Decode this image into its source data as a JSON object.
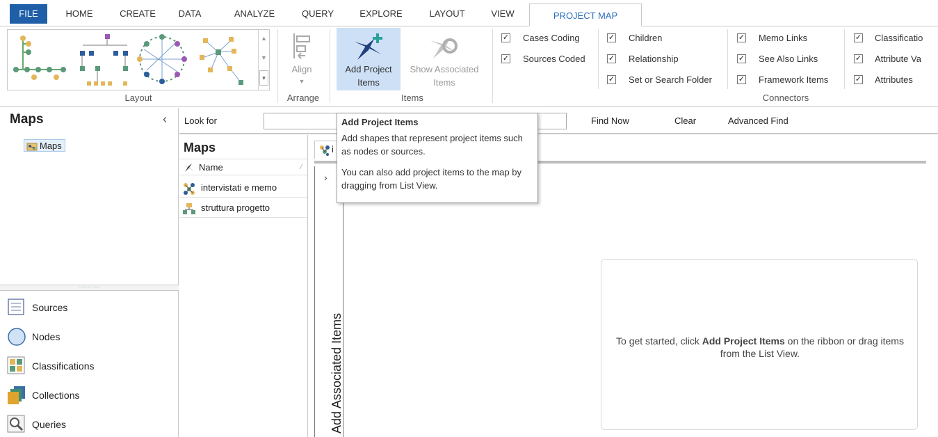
{
  "tabs": [
    {
      "label": "FILE"
    },
    {
      "label": "HOME"
    },
    {
      "label": "CREATE"
    },
    {
      "label": "DATA"
    },
    {
      "label": "ANALYZE"
    },
    {
      "label": "QUERY"
    },
    {
      "label": "EXPLORE"
    },
    {
      "label": "LAYOUT"
    },
    {
      "label": "VIEW"
    },
    {
      "label": "PROJECT MAP"
    }
  ],
  "ribbon": {
    "groups": {
      "layout": "Layout",
      "arrange": "Arrange",
      "items": "Items",
      "connectors": "Connectors"
    },
    "align_label": "Align",
    "add_project_items": {
      "line1": "Add Project",
      "line2": "Items"
    },
    "show_associated_items": {
      "line1": "Show Associated",
      "line2": "Items"
    },
    "checkboxes": [
      {
        "label": "Cases Coding",
        "checked": true
      },
      {
        "label": "Sources Coded",
        "checked": true
      },
      {
        "label": "Children",
        "checked": true
      },
      {
        "label": "Relationship",
        "checked": true
      },
      {
        "label": "Set or Search Folder",
        "checked": true
      },
      {
        "label": "Memo Links",
        "checked": true
      },
      {
        "label": "See Also Links",
        "checked": true
      },
      {
        "label": "Framework Items",
        "checked": true
      },
      {
        "label": "Classificatio",
        "checked": true
      },
      {
        "label": "Attribute Va",
        "checked": true
      },
      {
        "label": "Attributes",
        "checked": true
      }
    ],
    "check_mark": "✓"
  },
  "navigation": {
    "title": "Maps",
    "collapse_glyph": "‹",
    "tree_item": "Maps",
    "categories": [
      {
        "label": "Sources",
        "icon": "sources-icon"
      },
      {
        "label": "Nodes",
        "icon": "nodes-icon"
      },
      {
        "label": "Classifications",
        "icon": "classifications-icon"
      },
      {
        "label": "Collections",
        "icon": "collections-icon"
      },
      {
        "label": "Queries",
        "icon": "queries-icon"
      }
    ]
  },
  "find": {
    "look_for": "Look for",
    "find_now": "Find Now",
    "clear": "Clear",
    "advanced_find": "Advanced Find"
  },
  "list": {
    "title": "Maps",
    "column_name": "Name",
    "rows": [
      {
        "name": "intervistati e memo",
        "icon": "project-map-icon"
      },
      {
        "name": "struttura progetto",
        "icon": "concept-map-icon"
      }
    ]
  },
  "detail": {
    "doc_tab_label": "i",
    "side_panel_label": "Add Associated Items",
    "side_chevron": "›",
    "hint_prefix": "To get started, click ",
    "hint_bold": "Add Project Items",
    "hint_suffix": " on the ribbon or drag items from the List View."
  },
  "tooltip": {
    "title": "Add Project Items",
    "body1": "Add shapes that represent project items such as nodes or sources.",
    "body2": "You can also add project items to the map by dragging from List View."
  },
  "colors": {
    "file_tab": "#1f5fa8",
    "active_tab_text": "#2a6fbd",
    "pressed_button": "#cde0f5"
  }
}
